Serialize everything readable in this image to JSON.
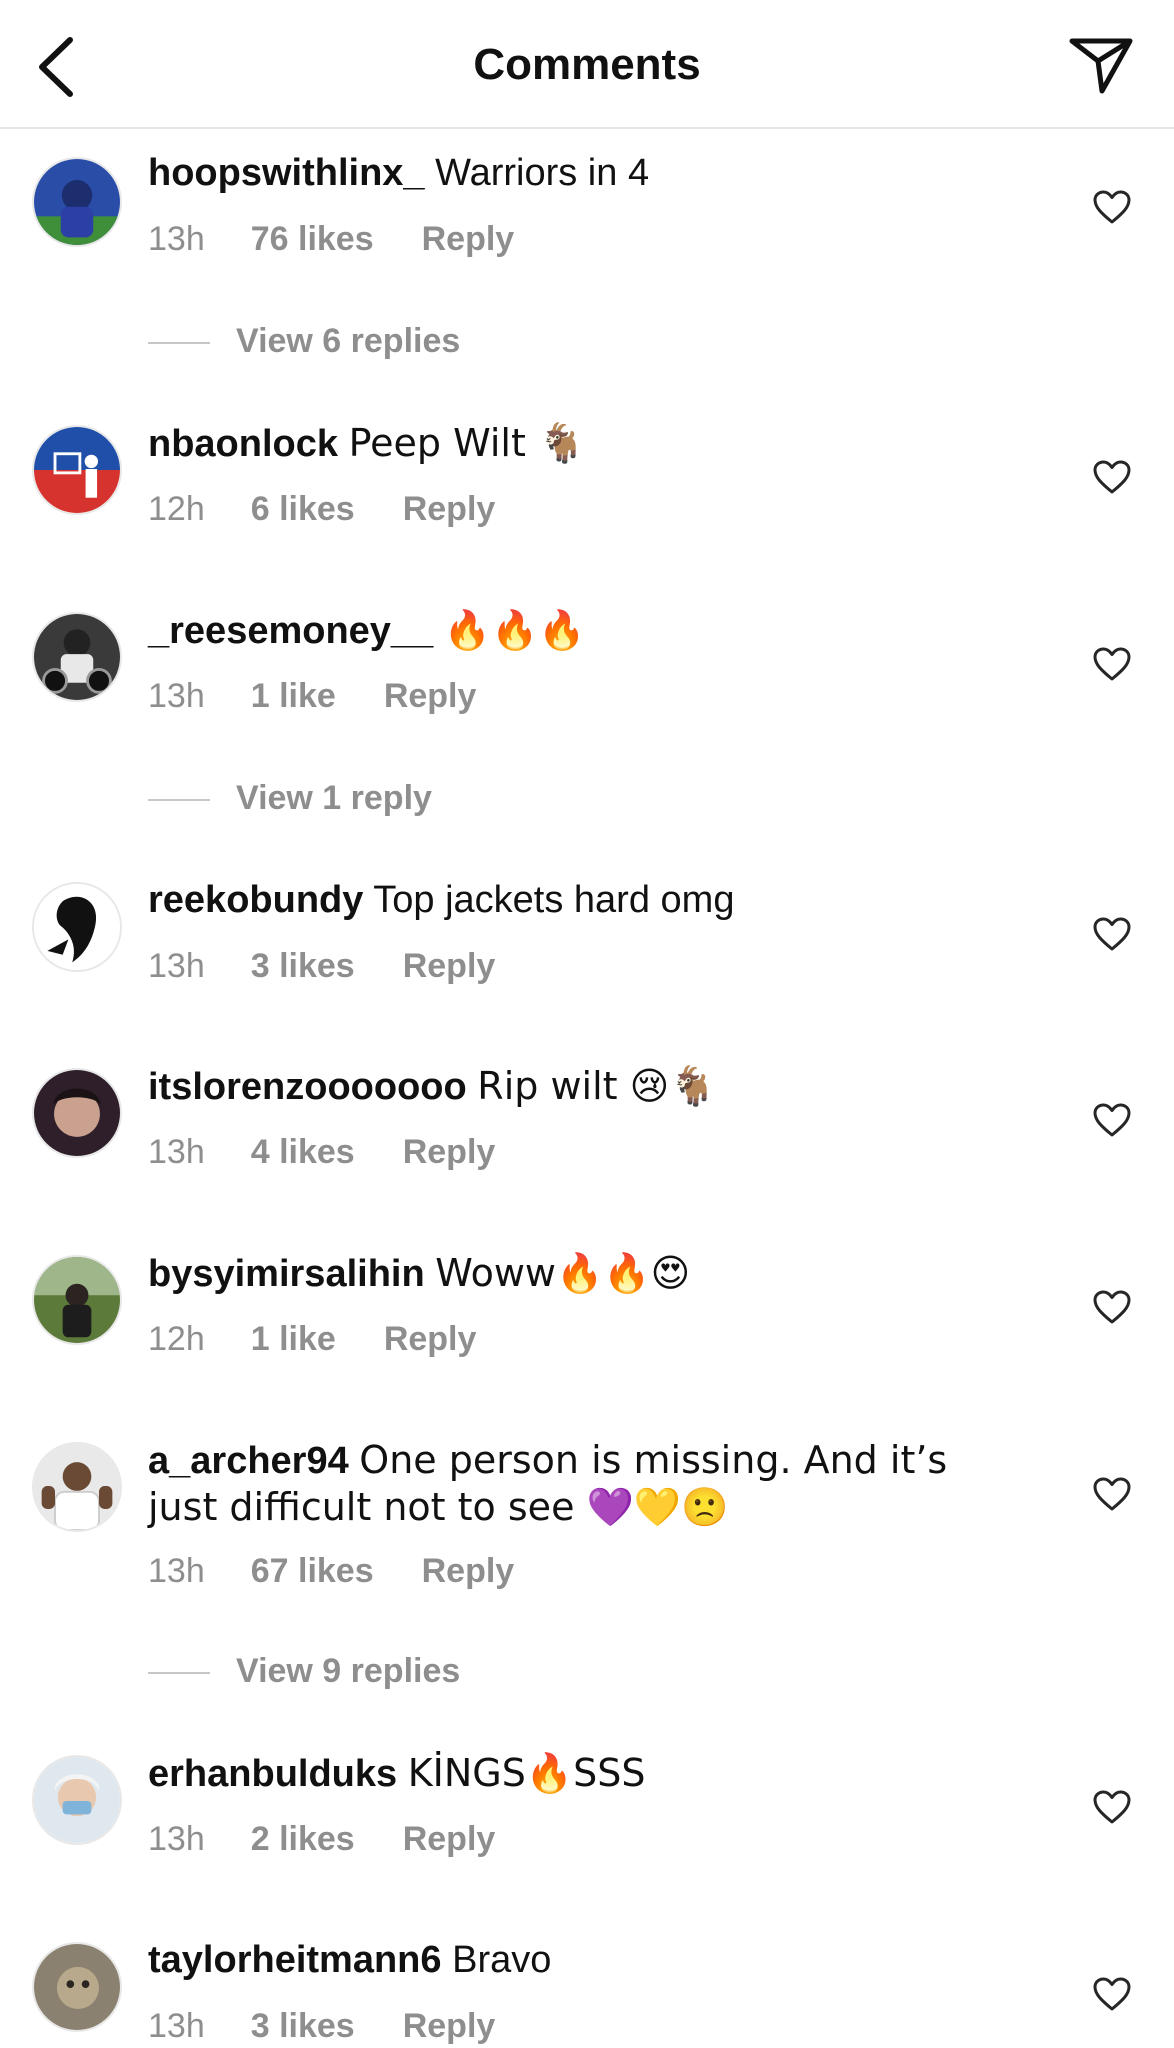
{
  "header": {
    "title": "Comments"
  },
  "comments": [
    {
      "user": "hoopswithlinx_",
      "text": "Warriors in 4",
      "time": "13h",
      "likes": "76 likes",
      "reply": "Reply",
      "view_replies": "View 6 replies"
    },
    {
      "user": "nbaonlock",
      "text": "Peep Wilt 🐐",
      "time": "12h",
      "likes": "6 likes",
      "reply": "Reply"
    },
    {
      "user": "_reesemoney__",
      "text": "🔥🔥🔥",
      "time": "13h",
      "likes": "1 like",
      "reply": "Reply",
      "view_replies": "View 1 reply"
    },
    {
      "user": "reekobundy",
      "text": "Top jackets hard omg",
      "time": "13h",
      "likes": "3 likes",
      "reply": "Reply"
    },
    {
      "user": "itslorenzooooooo",
      "text": "Rip wilt 😢🐐",
      "time": "13h",
      "likes": "4 likes",
      "reply": "Reply"
    },
    {
      "user": "bysyimirsalihin",
      "text": "Woww🔥🔥😍",
      "time": "12h",
      "likes": "1 like",
      "reply": "Reply"
    },
    {
      "user": "a_archer94",
      "text": "One person is missing. And it’s just difficult not to see 💜💛🙁",
      "time": "13h",
      "likes": "67 likes",
      "reply": "Reply",
      "view_replies": "View 9 replies"
    },
    {
      "user": "erhanbulduks",
      "text": "KİNGS🔥SSS",
      "time": "13h",
      "likes": "2 likes",
      "reply": "Reply"
    },
    {
      "user": "taylorheitmann6",
      "text": "Bravo",
      "time": "13h",
      "likes": "3 likes",
      "reply": "Reply"
    }
  ],
  "icons": {
    "back": "chevron-left-icon",
    "send": "paper-plane-icon",
    "like": "heart-outline-icon"
  },
  "colors": {
    "text": "#111111",
    "secondary": "#8e8e8e",
    "divider": "#e6e6e6"
  }
}
